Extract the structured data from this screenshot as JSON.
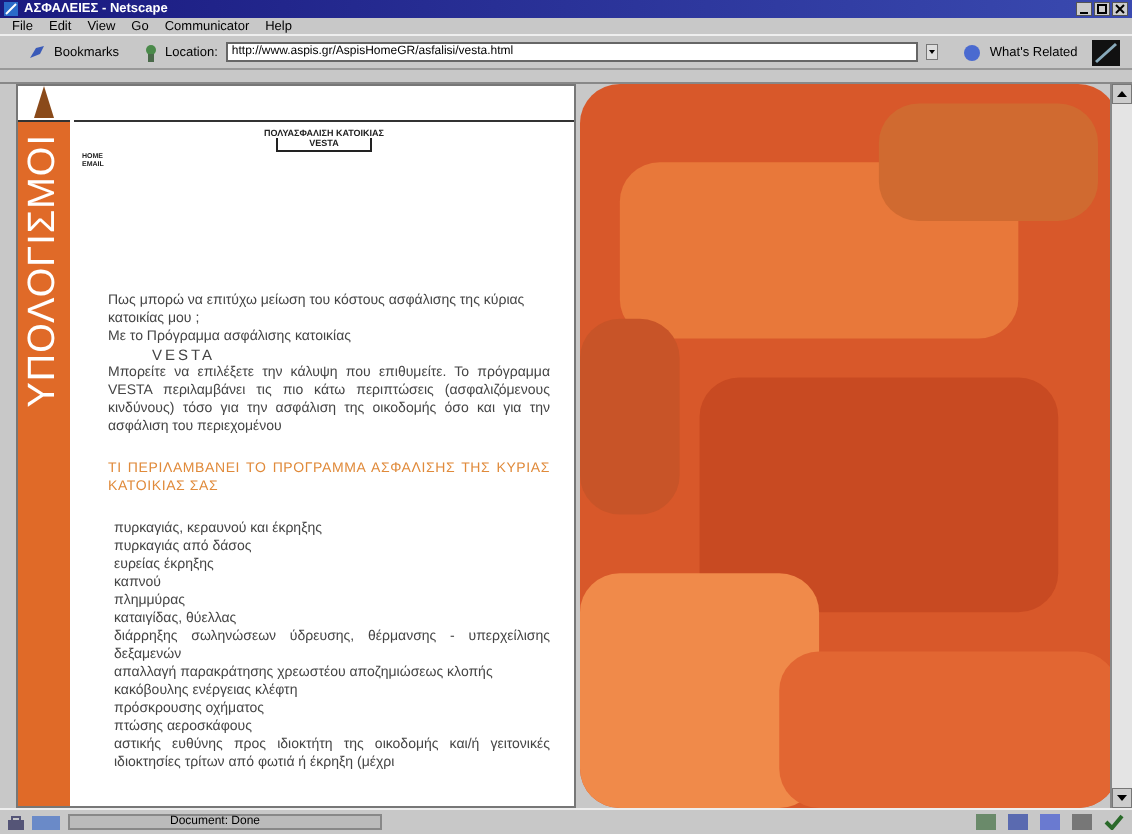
{
  "window": {
    "title": "ΑΣΦΑΛΕΙΕΣ - Netscape"
  },
  "menu": [
    "File",
    "Edit",
    "View",
    "Go",
    "Communicator",
    "Help"
  ],
  "location_bar": {
    "bookmarks": "Bookmarks",
    "location_label": "Location:",
    "url": "http://www.aspis.gr/AspisHomeGR/asfalisi/vesta.html",
    "related": "What's Related"
  },
  "page": {
    "side_title": "ΥΠΟΛΟΓΙΣΜΟΙ",
    "header": [
      "ΠΟΛΥΑΣΦΑΛΙΣΗ ΚΑΤΟΙΚΙΑΣ",
      "VESTA"
    ],
    "nav_links": [
      "HOME",
      "EMAIL"
    ],
    "intro": [
      "Πως μπορώ να επιτύχω μείωση του κόστους ασφάλισης της κύριας κατοικίας μου ;",
      "Με το Πρόγραμμα ασφάλισης κατοικίας"
    ],
    "product": "VESTA",
    "description": "Μπορείτε να επιλέξετε την κάλυψη που επιθυμείτε. Το πρόγραμμα VESTA περιλαμβάνει τις πιο κάτω περιπτώσεις (ασφαλιζόμενους κινδύνους) τόσο για την ασφάλιση της οικοδομής όσο και για την ασφάλιση του περιεχομένου",
    "section_heading": "ΤΙ ΠΕΡΙΛΑΜΒΑΝΕΙ ΤΟ ΠΡΟΓΡΑΜΜΑ ΑΣΦΑΛΙΣΗΣ ΤΗΣ ΚΥΡΙΑΣ ΚΑΤΟΙΚΙΑΣ ΣΑΣ",
    "covers": [
      "πυρκαγιάς, κεραυνού και έκρηξης",
      "πυρκαγιάς από δάσος",
      "ευρείας έκρηξης",
      "καπνού",
      "πλημμύρας",
      "καταιγίδας, θύελλας",
      "διάρρηξης σωληνώσεων ύδρευσης, θέρμανσης - υπερχείλισης δεξαμενών",
      "απαλλαγή παρακράτησης χρεωστέου αποζημιώσεως κλοπής",
      "κακόβουλης ενέργειας κλέφτη",
      "πρόσκρουσης οχήματος",
      "πτώσης αεροσκάφους",
      "αστικής ευθύνης προς ιδιοκτήτη της οικοδομής και/ή γειτονικές ιδιοκτησίες τρίτων από φωτιά ή έκρηξη (μέχρι"
    ]
  },
  "status_bar": {
    "text": "Document: Done"
  }
}
